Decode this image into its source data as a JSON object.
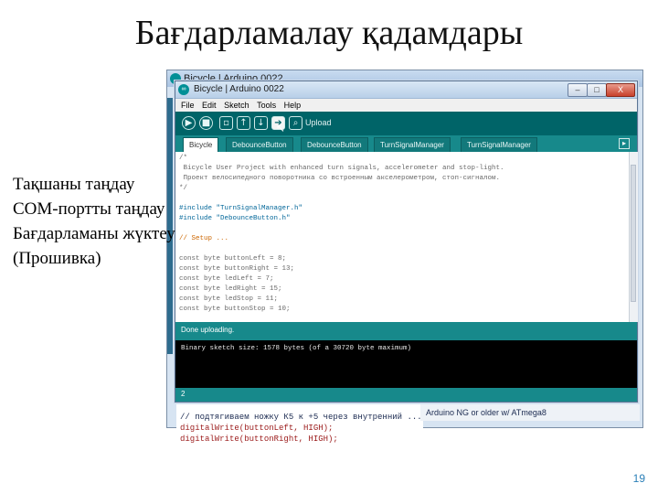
{
  "slide": {
    "title": "Бағдарламалау қадамдары",
    "bullets": [
      "Тақшаны таңдау",
      "COM-портты таңдау",
      "Бағдарламаны жүктеу",
      "(Прошивка)"
    ],
    "page_number": "19"
  },
  "back_window": {
    "title": "Bicycle | Arduino 0022",
    "code_lines": [
      "// подтягиваем ножку К5 к +5 через внутренний ...",
      "digitalWrite(buttonLeft, HIGH);",
      "digitalWrite(buttonRight, HIGH);"
    ],
    "status": "Arduino NG or older w/ ATmega8"
  },
  "window": {
    "title": "Bicycle | Arduino 0022",
    "controls": {
      "minimize": "–",
      "maximize": "□",
      "close": "X"
    },
    "menu": [
      "File",
      "Edit",
      "Sketch",
      "Tools",
      "Help"
    ],
    "toolbar": {
      "icons": [
        "verify-icon",
        "stop-icon",
        "new-icon",
        "open-icon",
        "save-icon",
        "upload-icon",
        "serial-monitor-icon"
      ],
      "label": "Upload"
    },
    "tabs": [
      "Bicycle",
      "DebounceButton",
      "DebounceButton",
      "TurnSignalManager",
      "TurnSignalManager"
    ],
    "editor_lines": [
      "/*",
      " Bicycle User Project with enhanced turn signals, accelerometer and stop-light.",
      " Проект велосипедного поворотника со встроенным акселерометром, стоп-сигналом.",
      "*/",
      "",
      "#include \"TurnSignalManager.h\"",
      "#include \"DebounceButton.h\"",
      "",
      "// Setup ...",
      "",
      "const byte buttonLeft = 8;",
      "const byte buttonRight = 13;",
      "const byte ledLeft = 7;",
      "const byte ledRight = 15;",
      "const byte ledStop = 11;",
      "const byte buttonStop = 10;"
    ],
    "status_message": "Done uploading.",
    "console_text": "Binary sketch size: 1578 bytes (of a 30720 byte maximum)",
    "footer_line": "2"
  }
}
